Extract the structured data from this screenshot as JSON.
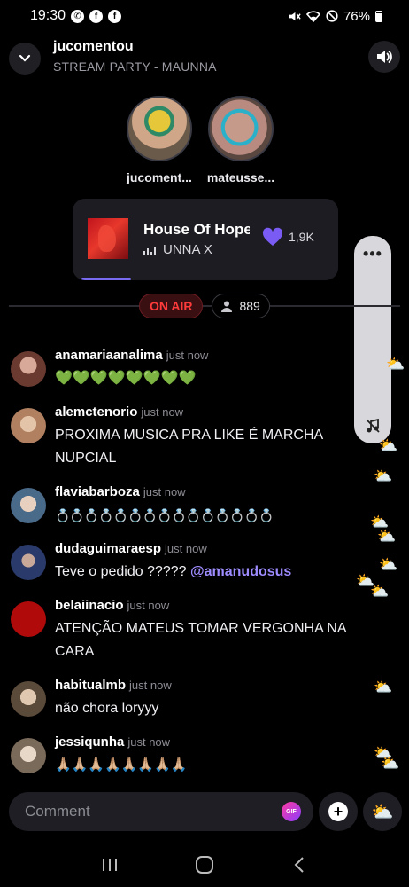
{
  "status_bar": {
    "time": "19:30",
    "battery": "76%",
    "left_icons": [
      "whatsapp-icon",
      "facebook-icon",
      "facebook-icon"
    ],
    "right_icons": [
      "mute-icon",
      "wifi-icon",
      "do-not-disturb-icon",
      "battery-icon"
    ]
  },
  "header": {
    "title": "jucomentou",
    "subtitle": "STREAM PARTY - MAUNNA"
  },
  "participants": [
    {
      "name": "jucoment..."
    },
    {
      "name": "mateusse..."
    }
  ],
  "now_playing": {
    "title": "House Of Hope",
    "artist": "UNNA X",
    "likes": "1,9K",
    "progress": 0.2
  },
  "live": {
    "on_air_label": "ON AIR",
    "viewers": "889"
  },
  "side_panel": {
    "more_label": "•••"
  },
  "comments": [
    {
      "user": "anamariaanalima",
      "time": "just now",
      "text": "💚💚💚💚💚💚💚💚"
    },
    {
      "user": "alemctenorio",
      "time": "just now",
      "text": "PROXIMA MUSICA PRA LIKE É MARCHA NUPCIAL"
    },
    {
      "user": "flaviabarboza",
      "time": "just now",
      "text": "💍💍💍💍💍💍💍💍💍💍💍💍💍💍💍"
    },
    {
      "user": "dudaguimaraesp",
      "time": "just now",
      "text": "Teve o pedido ????? ",
      "mention": "@amanudosus"
    },
    {
      "user": "belaiinacio",
      "time": "just now",
      "text": "ATENÇÃO MATEUS TOMAR VERGONHA NA CARA"
    },
    {
      "user": "habitualmb",
      "time": "just now",
      "text": "não chora loryyy"
    },
    {
      "user": "jessiqunha",
      "time": "just now",
      "text": "🙏🏼🙏🏼🙏🏼🙏🏼🙏🏼🙏🏼🙏🏼🙏🏼"
    }
  ],
  "floating_emoji": "⛅",
  "composer": {
    "placeholder": "Comment",
    "gif_label": "GIF",
    "add_label": "+",
    "reaction_emoji": "⛅"
  },
  "colors": {
    "accent": "#7a6cf2",
    "on_air": "#ff3b3b",
    "mention": "#9d8cff",
    "background": "#000000"
  }
}
